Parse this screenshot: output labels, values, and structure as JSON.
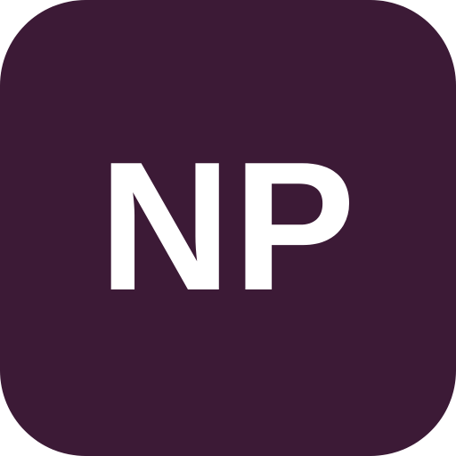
{
  "icon": {
    "monogram": "NP",
    "background_color": "#3c1a36",
    "text_color": "#ffffff"
  }
}
